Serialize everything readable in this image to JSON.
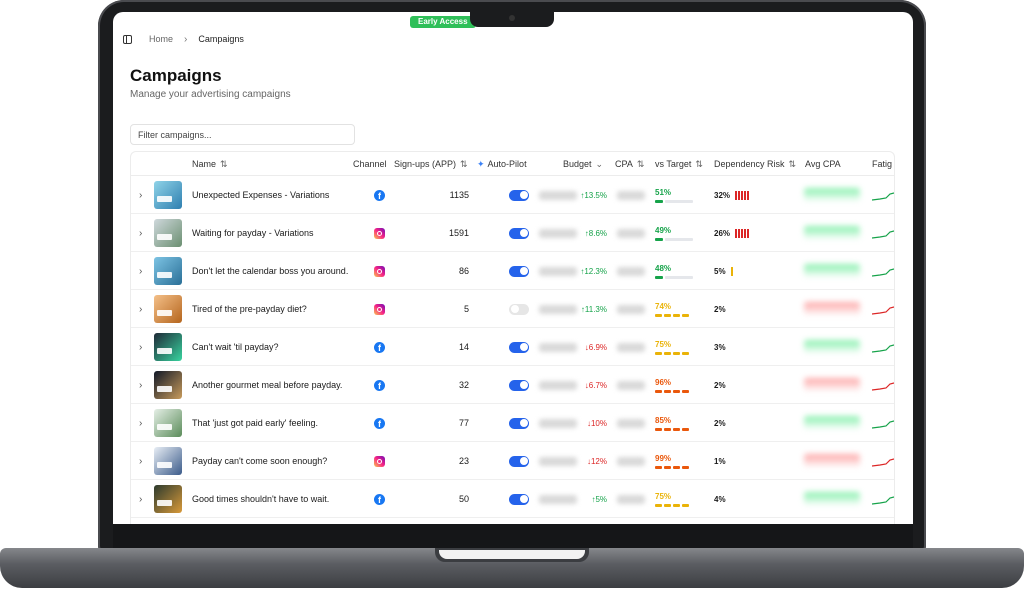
{
  "badge": "Early Access",
  "breadcrumb": {
    "home": "Home",
    "current": "Campaigns"
  },
  "page": {
    "title": "Campaigns",
    "subtitle": "Manage your advertising campaigns"
  },
  "filter": {
    "placeholder": "Filter campaigns...",
    "value": ""
  },
  "columns": {
    "name": "Name",
    "channel": "Channel",
    "signups": "Sign-ups (APP)",
    "autopilot": "Auto-Pilot",
    "budget": "Budget",
    "cpa": "CPA",
    "vs_target": "vs Target",
    "dependency": "Dependency Risk",
    "avg_cpa": "Avg CPA",
    "fatigue": "Fatig"
  },
  "colors": {
    "accent": "#2563eb",
    "good": "#16a34a",
    "warn": "#eab308",
    "bad": "#ea580c",
    "risk": "#dc2626"
  },
  "rows": [
    {
      "name": "Unexpected Expenses - Variations",
      "channel": "facebook",
      "signups": "1135",
      "autopilot": true,
      "delta": "↑13.5%",
      "dir": "up",
      "vs": "51%",
      "vs_level": "good",
      "risk": "32%",
      "risk_bars": 5,
      "risk_color": "#dc2626",
      "trend": "good",
      "thumb": [
        "#8fd3e8",
        "#2f7fb0"
      ]
    },
    {
      "name": "Waiting for payday - Variations",
      "channel": "instagram",
      "signups": "1591",
      "autopilot": true,
      "delta": "↑8.6%",
      "dir": "up",
      "vs": "49%",
      "vs_level": "good",
      "risk": "26%",
      "risk_bars": 5,
      "risk_color": "#dc2626",
      "trend": "good",
      "thumb": [
        "#cfd8dc",
        "#6b8f71"
      ]
    },
    {
      "name": "Don't let the calendar boss you around.",
      "channel": "instagram",
      "signups": "86",
      "autopilot": true,
      "delta": "↑12.3%",
      "dir": "up",
      "vs": "48%",
      "vs_level": "good",
      "risk": "5%",
      "risk_bars": 1,
      "risk_color": "#eab308",
      "trend": "good",
      "thumb": [
        "#7dc4e4",
        "#2a6f97"
      ]
    },
    {
      "name": "Tired of the pre-payday diet?",
      "channel": "instagram",
      "signups": "5",
      "autopilot": false,
      "delta": "↑11.3%",
      "dir": "up",
      "vs": "74%",
      "vs_level": "warn",
      "risk": "2%",
      "risk_bars": 0,
      "risk_color": "#dc2626",
      "trend": "bad",
      "thumb": [
        "#f4c089",
        "#b5651d"
      ]
    },
    {
      "name": "Can't wait 'til payday?",
      "channel": "facebook",
      "signups": "14",
      "autopilot": true,
      "delta": "↓6.9%",
      "dir": "down",
      "vs": "75%",
      "vs_level": "warn",
      "risk": "3%",
      "risk_bars": 0,
      "risk_color": "#dc2626",
      "trend": "good",
      "thumb": [
        "#1f2937",
        "#38d39f"
      ]
    },
    {
      "name": "Another gourmet meal before payday.",
      "channel": "facebook",
      "signups": "32",
      "autopilot": true,
      "delta": "↓6.7%",
      "dir": "down",
      "vs": "96%",
      "vs_level": "bad",
      "risk": "2%",
      "risk_bars": 0,
      "risk_color": "#dc2626",
      "trend": "bad",
      "thumb": [
        "#111827",
        "#c89b5b"
      ]
    },
    {
      "name": "That 'just got paid early' feeling.",
      "channel": "facebook",
      "signups": "77",
      "autopilot": true,
      "delta": "↓10%",
      "dir": "down",
      "vs": "85%",
      "vs_level": "bad",
      "risk": "2%",
      "risk_bars": 0,
      "risk_color": "#dc2626",
      "trend": "good",
      "thumb": [
        "#e5efe6",
        "#5b8c5a"
      ]
    },
    {
      "name": "Payday can't come soon enough?",
      "channel": "instagram",
      "signups": "23",
      "autopilot": true,
      "delta": "↓12%",
      "dir": "down",
      "vs": "99%",
      "vs_level": "bad",
      "risk": "1%",
      "risk_bars": 0,
      "risk_color": "#dc2626",
      "trend": "bad",
      "thumb": [
        "#e8eef5",
        "#3b5b8a"
      ]
    },
    {
      "name": "Good times shouldn't have to wait.",
      "channel": "facebook",
      "signups": "50",
      "autopilot": true,
      "delta": "↑5%",
      "dir": "up",
      "vs": "75%",
      "vs_level": "warn",
      "risk": "4%",
      "risk_bars": 0,
      "risk_color": "#dc2626",
      "trend": "good",
      "thumb": [
        "#2b3a2e",
        "#d99a3a"
      ]
    }
  ]
}
